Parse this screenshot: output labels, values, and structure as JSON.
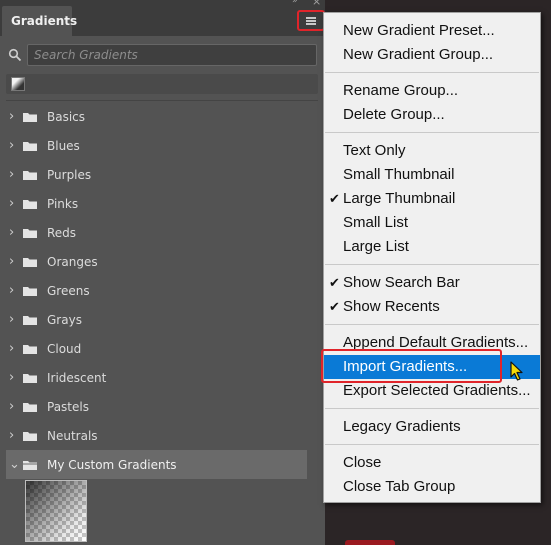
{
  "panel": {
    "tab_title": "Gradients",
    "search_placeholder": "Search Gradients",
    "groups": [
      {
        "label": "Basics"
      },
      {
        "label": "Blues"
      },
      {
        "label": "Purples"
      },
      {
        "label": "Pinks"
      },
      {
        "label": "Reds"
      },
      {
        "label": "Oranges"
      },
      {
        "label": "Greens"
      },
      {
        "label": "Grays"
      },
      {
        "label": "Cloud"
      },
      {
        "label": "Iridescent"
      },
      {
        "label": "Pastels"
      },
      {
        "label": "Neutrals"
      },
      {
        "label": "My Custom Gradients",
        "expanded": true,
        "selected": true
      }
    ]
  },
  "menu": {
    "new_gradient_preset": "New Gradient Preset...",
    "new_gradient_group": "New Gradient Group...",
    "rename_group": "Rename Group...",
    "delete_group": "Delete Group...",
    "text_only": "Text Only",
    "small_thumbnail": "Small Thumbnail",
    "large_thumbnail": "Large Thumbnail",
    "small_list": "Small List",
    "large_list": "Large List",
    "show_search_bar": "Show Search Bar",
    "show_recents": "Show Recents",
    "append_default_gradients": "Append Default Gradients...",
    "import_gradients": "Import Gradients...",
    "export_selected_gradients": "Export Selected Gradients...",
    "legacy_gradients": "Legacy Gradients",
    "close": "Close",
    "close_tab_group": "Close Tab Group",
    "checked_items": [
      "Large Thumbnail",
      "Show Search Bar",
      "Show Recents"
    ],
    "highlighted_item": "Import Gradients..."
  },
  "colors": {
    "panel_bg": "#535353",
    "menu_bg": "#f0f0f0",
    "highlight": "#0a7ad6",
    "annotation_red": "#e0242a"
  }
}
